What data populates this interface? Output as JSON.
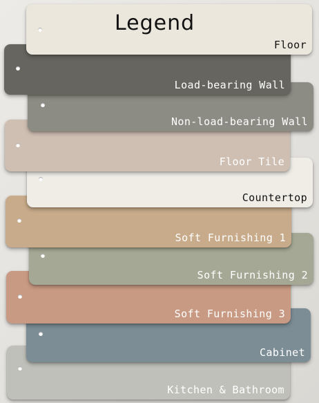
{
  "title": "Legend",
  "swatches": [
    {
      "label": "Floor",
      "color": "#ebe7dc",
      "text_color": "#111111"
    },
    {
      "label": "Load-bearing Wall",
      "color": "#66655f",
      "text_color": "#ffffff"
    },
    {
      "label": "Non-load-bearing Wall",
      "color": "#8d8c84",
      "text_color": "#ffffff"
    },
    {
      "label": "Floor Tile",
      "color": "#cfbfb3",
      "text_color": "#ffffff"
    },
    {
      "label": "Countertop",
      "color": "#efede6",
      "text_color": "#111111"
    },
    {
      "label": "Soft Furnishing 1",
      "color": "#c7ab8a",
      "text_color": "#ffffff"
    },
    {
      "label": "Soft Furnishing 2",
      "color": "#a4a894",
      "text_color": "#ffffff"
    },
    {
      "label": "Soft Furnishing 3",
      "color": "#c99a83",
      "text_color": "#ffffff"
    },
    {
      "label": "Cabinet",
      "color": "#7c8d96",
      "text_color": "#ffffff"
    },
    {
      "label": "Kitchen & Bathroom",
      "color": "#c0c0ba",
      "text_color": "#ffffff"
    }
  ]
}
